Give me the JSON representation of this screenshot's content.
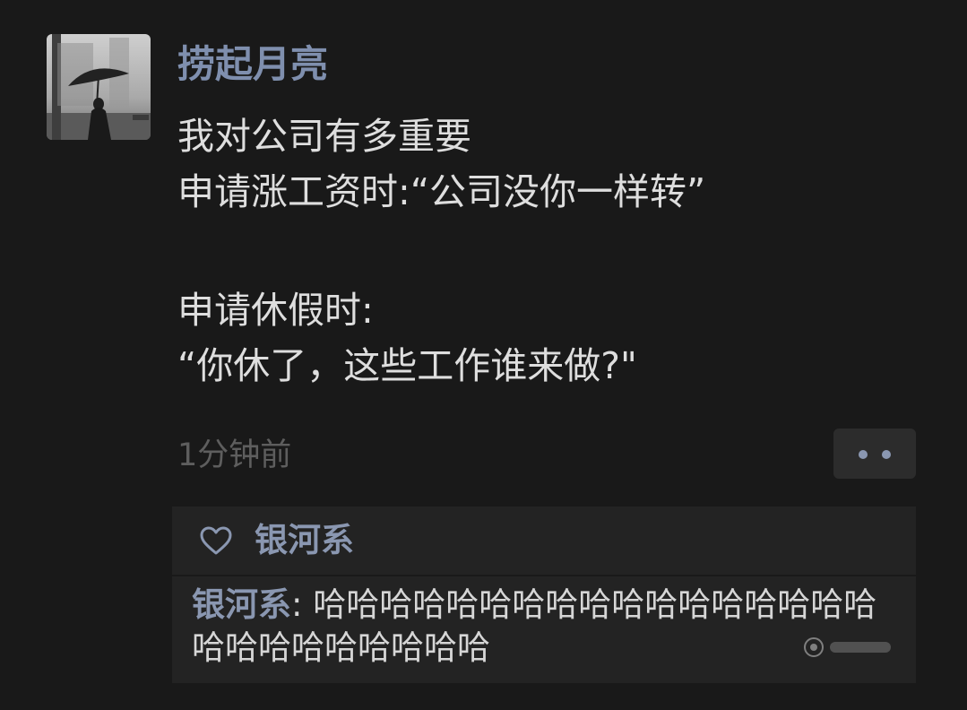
{
  "post": {
    "author": "捞起月亮",
    "lines": [
      "我对公司有多重要",
      "申请涨工资时:“公司没你一样转”",
      "",
      "申请休假时:",
      "“你休了，这些工作谁来做?\""
    ],
    "timestamp": "1分钟前"
  },
  "likes": {
    "names": "银河系"
  },
  "comments": [
    {
      "author": "银河系",
      "separator": ": ",
      "text": "哈哈哈哈哈哈哈哈哈哈哈哈哈哈哈哈哈哈哈哈哈哈哈哈哈哈"
    }
  ],
  "colors": {
    "background": "#191919",
    "name_link": "#8a97b1",
    "body_text": "#dedede",
    "timestamp": "#5e5e5e",
    "panel": "#232323"
  },
  "icons": {
    "more": "more-dots-icon",
    "like": "heart-outline-icon"
  }
}
